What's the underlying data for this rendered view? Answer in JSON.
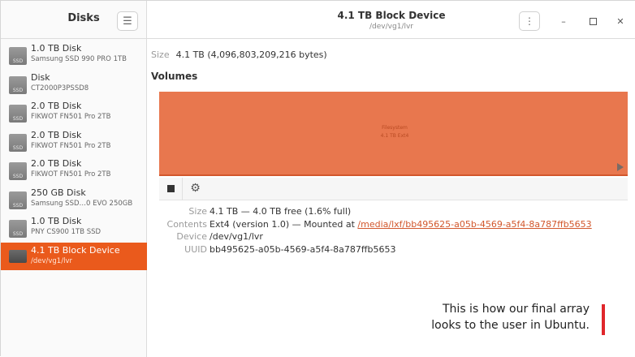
{
  "sidebar": {
    "title": "Disks",
    "menu_icon": "hamburger-icon",
    "items": [
      {
        "name": "1.0 TB Disk",
        "sub": "Samsung SSD 990 PRO 1TB",
        "icon_label": "SSD"
      },
      {
        "name": "Disk",
        "sub": "CT2000P3PSSD8",
        "icon_label": "SSD"
      },
      {
        "name": "2.0 TB Disk",
        "sub": "FIKWOT FN501 Pro 2TB",
        "icon_label": "SSD"
      },
      {
        "name": "2.0 TB Disk",
        "sub": "FIKWOT FN501 Pro 2TB",
        "icon_label": "SSD"
      },
      {
        "name": "2.0 TB Disk",
        "sub": "FIKWOT FN501 Pro 2TB",
        "icon_label": "SSD"
      },
      {
        "name": "250 GB Disk",
        "sub": "Samsung SSD…0 EVO 250GB",
        "icon_label": "SSD"
      },
      {
        "name": "1.0 TB Disk",
        "sub": "PNY CS900 1TB SSD",
        "icon_label": "SSD"
      },
      {
        "name": "4.1 TB Block Device",
        "sub": "/dev/vg1/lvr",
        "icon_label": "",
        "selected": true
      }
    ]
  },
  "header": {
    "title": "4.1 TB Block Device",
    "subtitle": "/dev/vg1/lvr",
    "kebab_icon": "vertical-dots-icon",
    "minimize_icon": "minimize-icon",
    "maximize_icon": "maximize-icon",
    "close_icon": "close-icon"
  },
  "main": {
    "size_label": "Size",
    "size_value": "4.1 TB (4,096,803,209,216 bytes)",
    "volumes_heading": "Volumes",
    "partition": {
      "line1": "Filesystem",
      "line2": "4.1 TB Ext4",
      "color": "#e8774e"
    },
    "details": {
      "size_label": "Size",
      "size_value": "4.1 TB — 4.0 TB free (1.6% full)",
      "contents_label": "Contents",
      "contents_value": "Ext4 (version 1.0) — Mounted at",
      "mount_link": "/media/lxf/bb495625-a05b-4569-a5f4-8a787ffb5653",
      "device_label": "Device",
      "device_value": "/dev/vg1/lvr",
      "uuid_label": "UUID",
      "uuid_value": "bb495625-a05b-4569-a5f4-8a787ffb5653"
    }
  },
  "caption": {
    "line1": "This is how our final array",
    "line2": "looks to the user in Ubuntu.",
    "accent": "#e0262b"
  },
  "colors": {
    "selection": "#ea5a1c",
    "partition": "#e8774e"
  }
}
